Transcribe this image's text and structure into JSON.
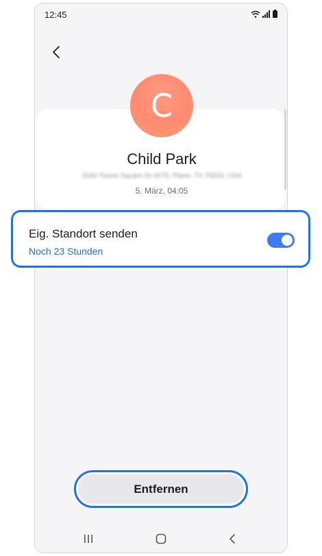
{
  "status_bar": {
    "time": "12:45",
    "icons": [
      "wifi-icon",
      "signal-icon",
      "battery-icon"
    ]
  },
  "header": {
    "back_icon": "chevron-left-icon"
  },
  "contact": {
    "avatar_letter": "C",
    "name": "Child Park",
    "address": "3340 Towne Square Dr #275, Plano, TX 75024, USA",
    "datetime": "5. März, 04:05"
  },
  "location_share": {
    "title": "Eig. Standort senden",
    "subtitle": "Noch 23 Stunden",
    "enabled": true
  },
  "actions": {
    "remove_label": "Entfernen"
  },
  "nav_bar": {
    "items": [
      "recents-icon",
      "home-icon",
      "back-icon"
    ]
  },
  "colors": {
    "accent": "#3e7bf5",
    "highlight": "#1a73e8",
    "avatar": "#ff8a70"
  }
}
